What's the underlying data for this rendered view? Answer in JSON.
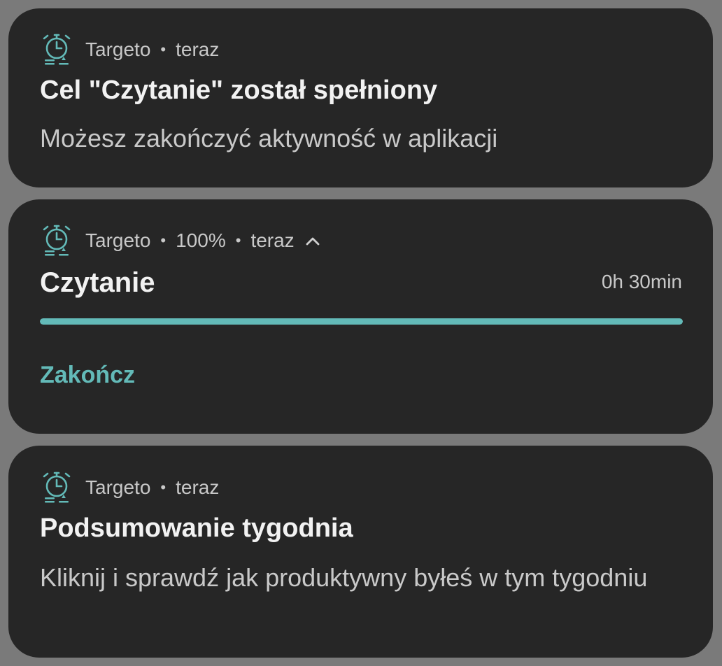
{
  "accent_color": "#63bab8",
  "notifications": [
    {
      "app_name": "Targeto",
      "time": "teraz",
      "title": "Cel \"Czytanie\" został spełniony",
      "body": "Możesz zakończyć aktywność w aplikacji",
      "icon": "alarm-clock-icon"
    },
    {
      "app_name": "Targeto",
      "progress_label": "100%",
      "time": "teraz",
      "expand_icon": "chevron-up-icon",
      "title": "Czytanie",
      "duration": "0h 30min",
      "progress": 1.0,
      "action_label": "Zakończ",
      "icon": "alarm-clock-icon"
    },
    {
      "app_name": "Targeto",
      "time": "teraz",
      "title": "Podsumowanie tygodnia",
      "body": "Kliknij i sprawdź jak produktywny byłeś w tym tygodniu",
      "icon": "alarm-clock-icon"
    }
  ]
}
